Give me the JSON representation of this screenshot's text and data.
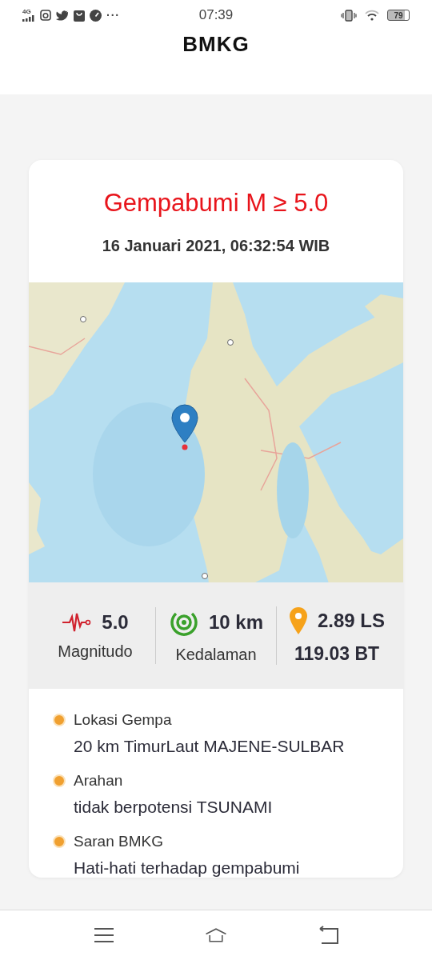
{
  "status_bar": {
    "network": "4G",
    "more": "···",
    "time": "07:39",
    "battery": "79"
  },
  "header": {
    "title": "BMKG"
  },
  "card": {
    "title": "Gempabumi M ≥ 5.0",
    "datetime": "16 Januari 2021, 06:32:54 WIB",
    "stats": [
      {
        "kind": "magnitude",
        "value": "5.0",
        "label": "Magnitudo"
      },
      {
        "kind": "depth",
        "value": "10 km",
        "label": "Kedalaman"
      },
      {
        "kind": "location",
        "value": "2.89 LS",
        "label": "119.03 BT"
      }
    ],
    "details": [
      {
        "label": "Lokasi Gempa",
        "value": "20 km TimurLaut MAJENE-SULBAR"
      },
      {
        "label": "Arahan",
        "value": "tidak berpotensi TSUNAMI"
      },
      {
        "label": "Saran BMKG",
        "value": "Hati-hati terhadap gempabumi"
      }
    ]
  }
}
